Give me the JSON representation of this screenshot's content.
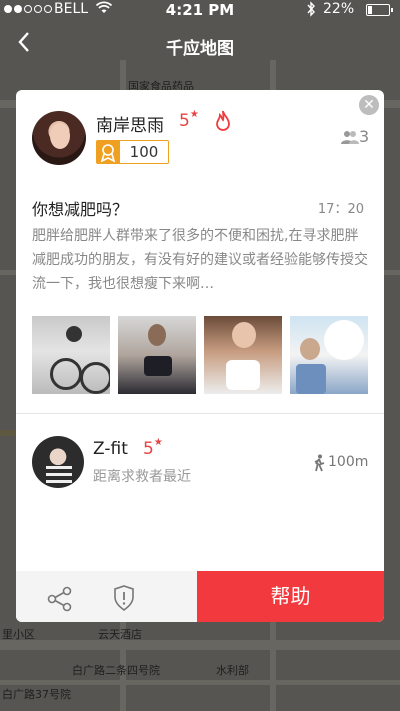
{
  "status_bar": {
    "carrier": "BELL",
    "time": "4:21 PM",
    "battery_percent": "22%",
    "battery_level": 0.22
  },
  "nav": {
    "title": "千应地图"
  },
  "map_labels": [
    "国家食品药品",
    "里小区",
    "云天酒店",
    "白广路二条四号院",
    "水利部",
    "白广路37号院"
  ],
  "card": {
    "poster": {
      "name": "南岸思雨",
      "level": "5",
      "badge_score": "100",
      "group_count": "3"
    },
    "post": {
      "title": "你想减肥吗？",
      "time": "17：20",
      "body": "肥胖给肥胖人群带来了很多的不便和困扰,在寻求肥胖减肥成功的朋友，有没有好的建议或者经验能够传授交流一下，我也很想瘦下来啊…"
    },
    "helper": {
      "name": "Z-fit",
      "level": "5",
      "description": "距离求救者最近",
      "distance": "100m"
    },
    "actions": {
      "help_label": "帮助"
    }
  },
  "colors": {
    "accent_red": "#f2393e",
    "badge_orange": "#f0a020"
  },
  "icons": [
    "signal-icon",
    "wifi-icon",
    "bluetooth-icon",
    "battery-icon",
    "back-arrow-icon",
    "close-icon",
    "fire-icon",
    "medal-icon",
    "group-icon",
    "walk-icon",
    "share-icon",
    "report-shield-icon"
  ]
}
